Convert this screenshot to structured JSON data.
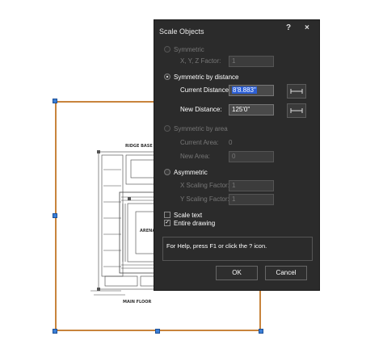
{
  "dialog": {
    "title": "Scale Objects",
    "help_label": "?",
    "close_label": "×",
    "symmetric": {
      "label": "Symmetric",
      "checked": false
    },
    "xyz_factor": {
      "label": "X, Y, Z Factor:",
      "value": "1"
    },
    "by_distance": {
      "label": "Symmetric by distance",
      "checked": true
    },
    "current_distance": {
      "label": "Current Distance:",
      "value": "8'8.883\""
    },
    "new_distance": {
      "label": "New Distance:",
      "value": "125'0\""
    },
    "by_area": {
      "label": "Symmetric by area",
      "checked": false
    },
    "current_area": {
      "label": "Current Area:",
      "value": "0"
    },
    "new_area": {
      "label": "New Area:",
      "value": "0"
    },
    "asymmetric": {
      "label": "Asymmetric",
      "checked": false
    },
    "x_scaling": {
      "label": "X Scaling Factor:",
      "value": "1"
    },
    "y_scaling": {
      "label": "Y Scaling Factor:",
      "value": "1"
    },
    "scale_text": {
      "label": "Scale text",
      "checked": false
    },
    "entire_drawing": {
      "label": "Entire drawing",
      "checked": true
    },
    "help_text": "For Help, press F1 or click the ? icon.",
    "ok_label": "OK",
    "cancel_label": "Cancel"
  },
  "drawing": {
    "top_label": "RIDGE BASE",
    "mid_label": "ARENA",
    "bottom_label": "MAIN FLOOR"
  },
  "colors": {
    "dialog_bg": "#2b2b2b",
    "selection_border": "#c8843c",
    "handle": "#3b7fd6",
    "text_selection": "#2c5fd6"
  }
}
